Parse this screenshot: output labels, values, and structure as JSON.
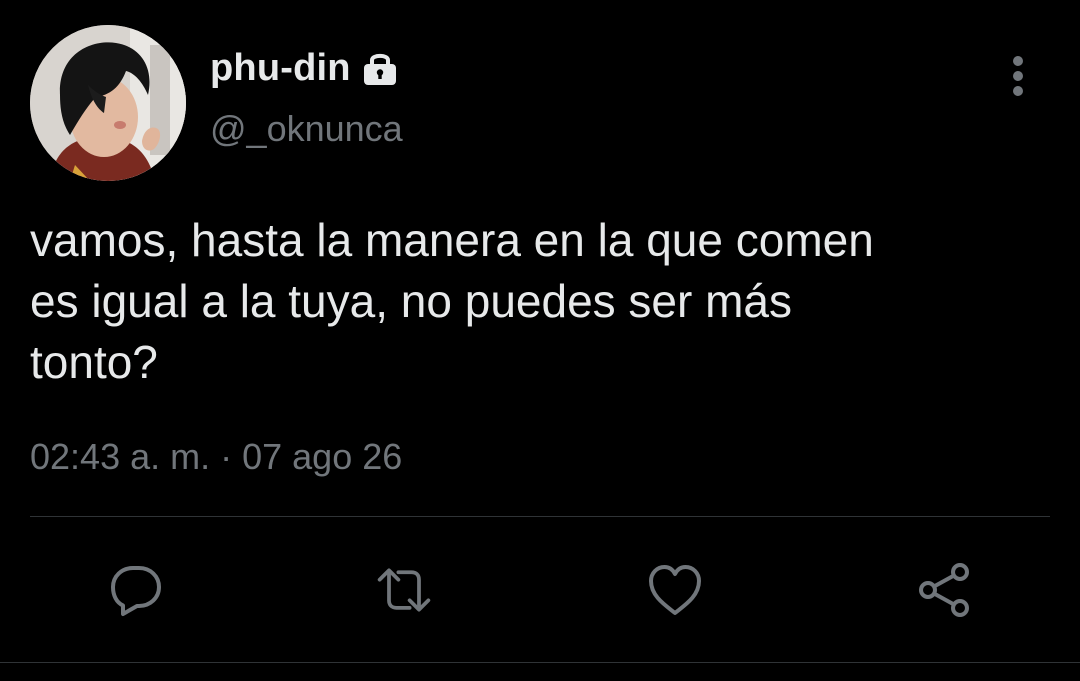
{
  "user": {
    "display_name": "phu-din",
    "handle": "@_oknunca",
    "protected_icon": "lock-icon",
    "avatar": "profile-photo"
  },
  "tweet": {
    "text": "vamos, hasta la manera en la que comen\nes igual a la tuya, no puedes ser más\ntonto?",
    "time": "02:43 a. m.",
    "separator": "·",
    "date": "07 ago 26"
  },
  "actions": [
    {
      "icon": "reply-icon"
    },
    {
      "icon": "retweet-icon"
    },
    {
      "icon": "like-icon"
    },
    {
      "icon": "share-icon"
    }
  ],
  "menu": {
    "icon": "more-vertical-icon"
  },
  "colors": {
    "background": "#000000",
    "text_primary": "#e7e9ea",
    "text_secondary": "#71767b",
    "divider": "#2f3336"
  }
}
